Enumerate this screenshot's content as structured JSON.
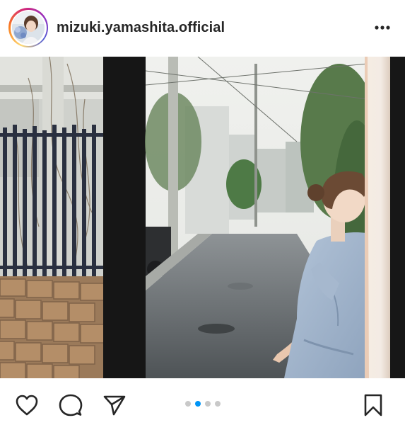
{
  "header": {
    "username": "mizuki.yamashita.official",
    "avatar_icon": "profile-avatar",
    "more_icon": "more-horizontal-icon"
  },
  "post": {
    "image_icon": "post-photo",
    "carousel": {
      "count": 4,
      "active_index": 1,
      "active_color": "#0095f6",
      "inactive_color": "#c9c9c9"
    }
  },
  "actions": {
    "like_icon": "heart-icon",
    "comment_icon": "comment-icon",
    "share_icon": "send-icon",
    "save_icon": "bookmark-icon"
  }
}
